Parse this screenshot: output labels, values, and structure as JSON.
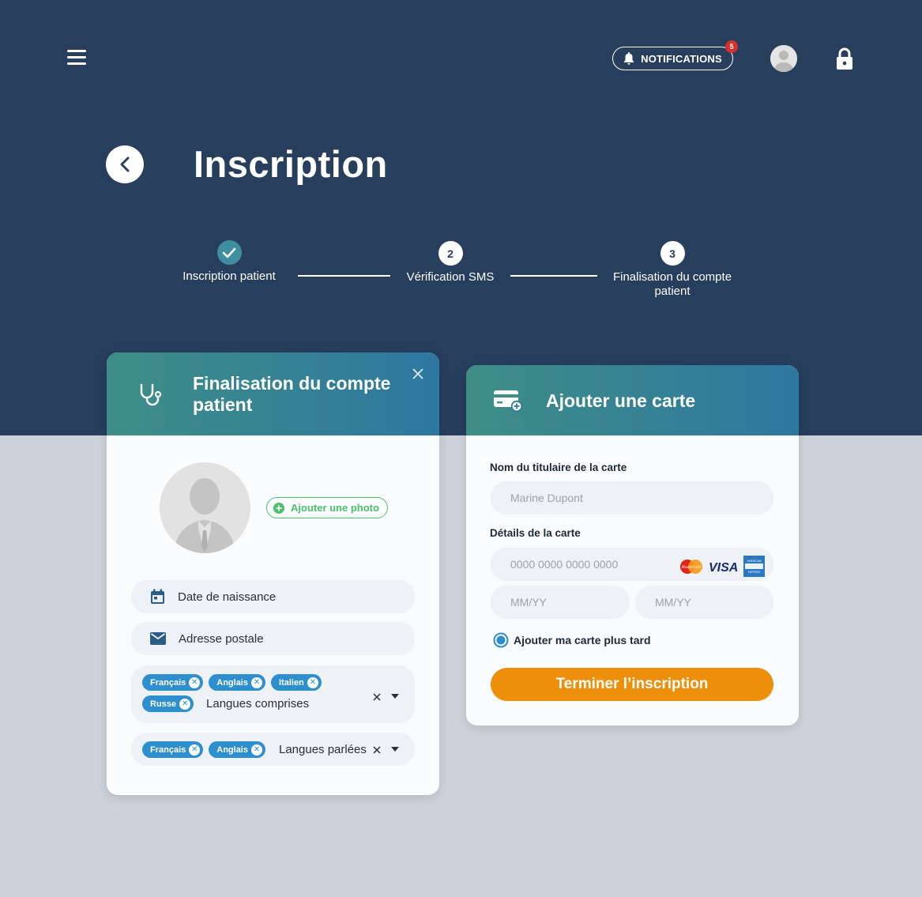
{
  "topbar": {
    "notifications_label": "NOTIFICATIONS",
    "notifications_count": "5"
  },
  "page": {
    "title": "Inscription"
  },
  "steps": [
    {
      "label": "Inscription patient",
      "state": "done"
    },
    {
      "number": "2",
      "label": "Vérification SMS"
    },
    {
      "number": "3",
      "label_line1": "Finalisation du compte",
      "label_line2": "patient"
    }
  ],
  "patient_card": {
    "title_line1": "Finalisation du compte",
    "title_line2": "patient",
    "add_photo_label": "Ajouter une photo",
    "birth_date_placeholder": "Date de naissance",
    "address_placeholder": "Adresse postale",
    "languages_understood": {
      "tags": [
        "Français",
        "Anglais",
        "Italien",
        "Russe"
      ],
      "placeholder": "Langues comprises"
    },
    "languages_spoken": {
      "tags": [
        "Français",
        "Anglais"
      ],
      "placeholder": "Langues parlées"
    }
  },
  "card_form": {
    "title": "Ajouter une carte",
    "holder_label": "Nom du titulaire de la carte",
    "holder_placeholder": "Marine Dupont",
    "details_label": "Détails de la carte",
    "number_placeholder": "0000 0000 0000 0000",
    "expiry_placeholder": "MM/YY",
    "cvc_placeholder": "MM/YY",
    "brands": [
      "MasterCard",
      "VISA",
      "AMERICAN EXPRESS"
    ],
    "later_option": "Ajouter ma carte plus tard",
    "submit_label": "Terminer l’inscription"
  },
  "colors": {
    "header_bg": "#273e5d",
    "accent": "#2e8fcf",
    "submit": "#ee8f0a",
    "success": "#4cc06a",
    "badge": "#d9302c"
  }
}
